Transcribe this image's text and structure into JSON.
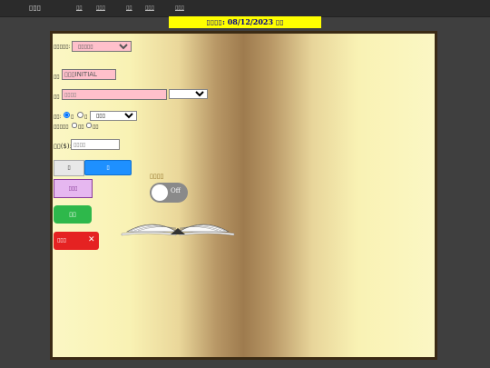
{
  "header": {
    "brand": "▯▯▯",
    "nav": [
      "▯▯",
      "▯▯▯",
      "▯▯",
      "▯▯▯",
      "▯▯▯"
    ]
  },
  "date_banner": "▯▯▯▯: 08/12/2023 ▯▯",
  "form": {
    "select1_label": "▯▯▯▯▯:",
    "select1_value": "▯▯▯▯▯",
    "input1_label": "▯▯",
    "input1_value": "▯▯▯INITIAL",
    "input2_label": "▯▯",
    "input2_placeholder": "▯▯▯▯",
    "select2_value": "",
    "radio_label": "▯▯:",
    "radio1_label": "▯",
    "radio2_label": "▯",
    "select3_value": "▯▯▯",
    "checkbox_label": "▯▯▯▯▯",
    "check1_label": "▯▯",
    "check2_label": "▯▯",
    "number_label": "▯▯($):",
    "number_placeholder": "▯▯▯▯"
  },
  "buttons": {
    "gray": "▯",
    "blue": "▯",
    "violet": "▯▯▯",
    "green": "▯▯",
    "red": "▯▯▯",
    "red_close": "✕"
  },
  "toggle": {
    "label": "▯▯▯▯",
    "state": "Off",
    "on": false
  }
}
